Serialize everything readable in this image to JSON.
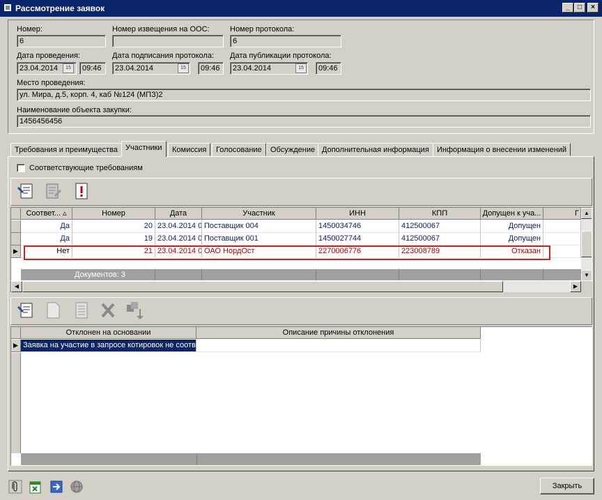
{
  "window": {
    "title": "Рассмотрение заявок"
  },
  "form": {
    "number_label": "Номер:",
    "number_value": "6",
    "notice_label": "Номер извещения на ООС:",
    "notice_value": "",
    "protocol_label": "Номер протокола:",
    "protocol_value": "6",
    "date_held_label": "Дата проведения:",
    "date_held_value": "23.04.2014",
    "time_held_value": "09:46",
    "date_signed_label": "Дата подписания протокола:",
    "date_signed_value": "23.04.2014",
    "time_signed_value": "09:46",
    "date_published_label": "Дата публикации протокола:",
    "date_published_value": "23.04.2014",
    "time_published_value": "09:46",
    "place_label": "Место проведения:",
    "place_value": "ул. Мира, д.5, корп. 4, каб №124 (МПЗ)2",
    "object_label": "Наименование объекта закупки:",
    "object_value": "1456456456"
  },
  "tabs": [
    "Требования и преимущества",
    "Участники",
    "Комиссия",
    "Голосование",
    "Обсуждение",
    "Дополнительная информация",
    "Информация о внесении изменений"
  ],
  "participants": {
    "filter_label": "Соответствующие требованиям",
    "columns": [
      "Соответ...",
      "Номер",
      "Дата",
      "Участник",
      "ИНН",
      "КПП",
      "Допущен к уча...",
      "Г"
    ],
    "rows": [
      {
        "match": "Да",
        "number": "20",
        "date": "23.04.2014 09",
        "participant": "Поставщик 004",
        "inn": "1450034746",
        "kpp": "412500067",
        "admitted": "Допущен"
      },
      {
        "match": "Да",
        "number": "19",
        "date": "23.04.2014 09",
        "participant": "Поставщик 001",
        "inn": "1450027744",
        "kpp": "412500067",
        "admitted": "Допущен"
      },
      {
        "match": "Нет",
        "number": "21",
        "date": "23.04.2014 09",
        "participant": "ОАО НордОст",
        "inn": "2270006776",
        "kpp": "223008789",
        "admitted": "Отказан"
      }
    ],
    "footer_count": "Документов: 3"
  },
  "reasons": {
    "columns": [
      "Отклонен на основании",
      "Описание причины отклонения"
    ],
    "rows": [
      {
        "basis": "Заявка на участие в запросе котировок не соотв",
        "description": ""
      }
    ]
  },
  "bottom": {
    "close_label": "Закрыть"
  },
  "icons": [
    "paperclip-icon",
    "excel-export-icon",
    "forward-icon",
    "globe-icon",
    "edit-document-icon",
    "document-lines-icon",
    "document-exclamation-icon",
    "new-document-icon",
    "list-document-icon",
    "delete-x-icon",
    "copy-down-icon"
  ],
  "colors": {
    "titlebar": "#0a246a",
    "highlight_border": "#d02020",
    "row_text": "#0a246a",
    "rejected_text": "#b00000"
  }
}
